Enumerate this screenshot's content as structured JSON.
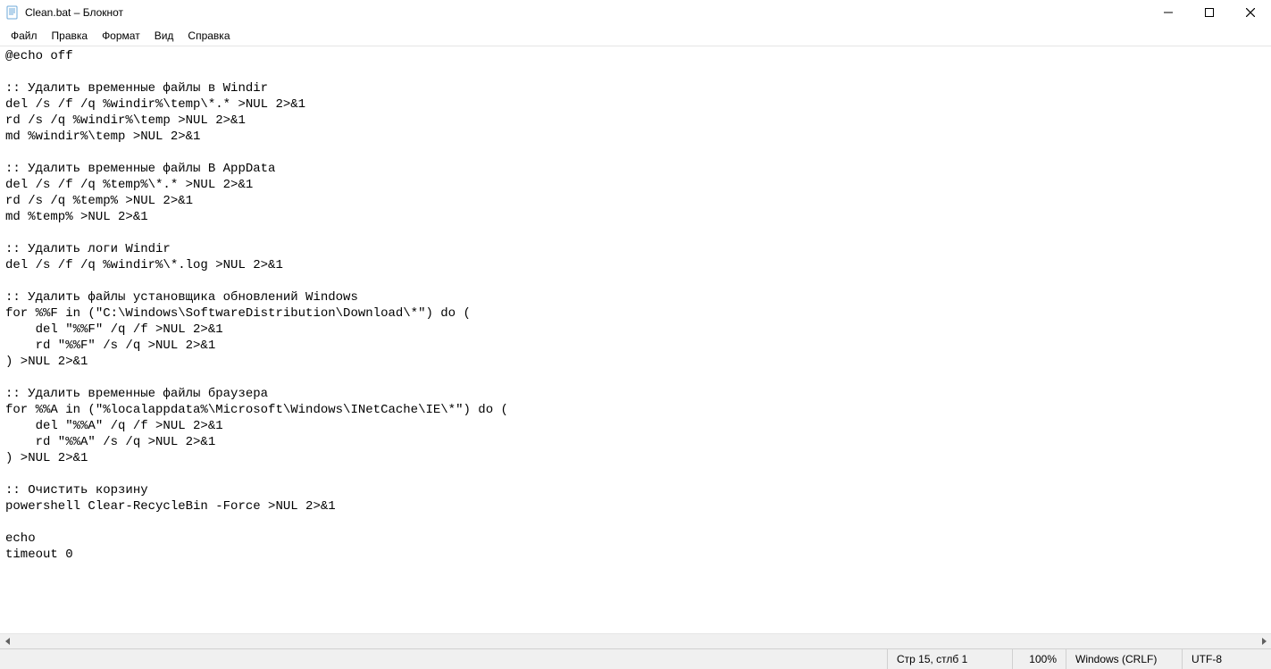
{
  "title": "Clean.bat – Блокнот",
  "menu": {
    "file": "Файл",
    "edit": "Правка",
    "format": "Формат",
    "view": "Вид",
    "help": "Справка"
  },
  "editor_text": "@echo off\n\n:: Удалить временные файлы в Windir\ndel /s /f /q %windir%\\temp\\*.* >NUL 2>&1\nrd /s /q %windir%\\temp >NUL 2>&1\nmd %windir%\\temp >NUL 2>&1\n\n:: Удалить временные файлы В AppData\ndel /s /f /q %temp%\\*.* >NUL 2>&1\nrd /s /q %temp% >NUL 2>&1\nmd %temp% >NUL 2>&1\n\n:: Удалить логи Windir\ndel /s /f /q %windir%\\*.log >NUL 2>&1\n\n:: Удалить файлы установщика обновлений Windows\nfor %%F in (\"C:\\Windows\\SoftwareDistribution\\Download\\*\") do (\n    del \"%%F\" /q /f >NUL 2>&1\n    rd \"%%F\" /s /q >NUL 2>&1\n) >NUL 2>&1\n\n:: Удалить временные файлы браузера\nfor %%A in (\"%localappdata%\\Microsoft\\Windows\\INetCache\\IE\\*\") do (\n    del \"%%A\" /q /f >NUL 2>&1\n    rd \"%%A\" /s /q >NUL 2>&1\n) >NUL 2>&1\n\n:: Очистить корзину\npowershell Clear-RecycleBin -Force >NUL 2>&1\n\necho\ntimeout 0",
  "status": {
    "position": "Стр 15, стлб 1",
    "zoom": "100%",
    "eol": "Windows (CRLF)",
    "encoding": "UTF-8"
  }
}
